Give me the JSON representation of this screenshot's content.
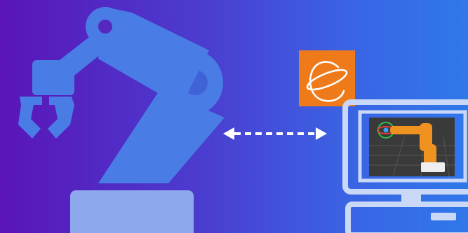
{
  "scene": {
    "robot_arm": {
      "icon": "robot-arm-icon",
      "color": "#4f80e6",
      "base_color": "#8aa6ee"
    },
    "link": {
      "icon": "bidirectional-arrow-icon",
      "style": "dashed",
      "color": "#ffffff"
    },
    "app_logo": {
      "icon": "orbit-logo-icon",
      "background": "#ee7a1a",
      "stroke": "#ffffff"
    },
    "computer": {
      "icon": "desktop-computer-icon",
      "frame_color": "#c9d8f6",
      "screen": {
        "content": "3d-robot-arm-simulation",
        "background": "#3a3a3a",
        "arm_color": "#f0921f"
      }
    }
  }
}
